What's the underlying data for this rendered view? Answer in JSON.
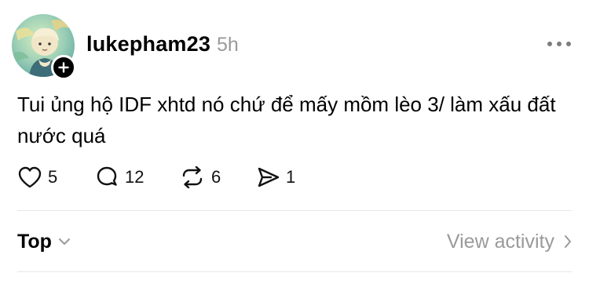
{
  "post": {
    "author": {
      "username": "lukepham23",
      "avatar_icon": "anime-character-avatar",
      "follow_icon": "plus-icon"
    },
    "timestamp": "5h",
    "more_icon": "more-horizontal-icon",
    "text": "Tui ủng hộ IDF xhtd nó chứ để mấy mồm lèo 3/ làm xấu đất nước quá",
    "actions": {
      "like": {
        "icon": "heart-icon",
        "count": "5"
      },
      "reply": {
        "icon": "comment-icon",
        "count": "12"
      },
      "repost": {
        "icon": "repost-icon",
        "count": "6"
      },
      "share": {
        "icon": "send-icon",
        "count": "1"
      }
    }
  },
  "replies_bar": {
    "sort_label": "Top",
    "sort_icon": "chevron-down-icon",
    "view_activity_label": "View activity",
    "view_activity_icon": "chevron-right-icon"
  },
  "colors": {
    "text": "#000000",
    "muted": "#9a9a9a",
    "divider": "#e6e6e6",
    "avatar_bg": "#8fc7b4"
  }
}
